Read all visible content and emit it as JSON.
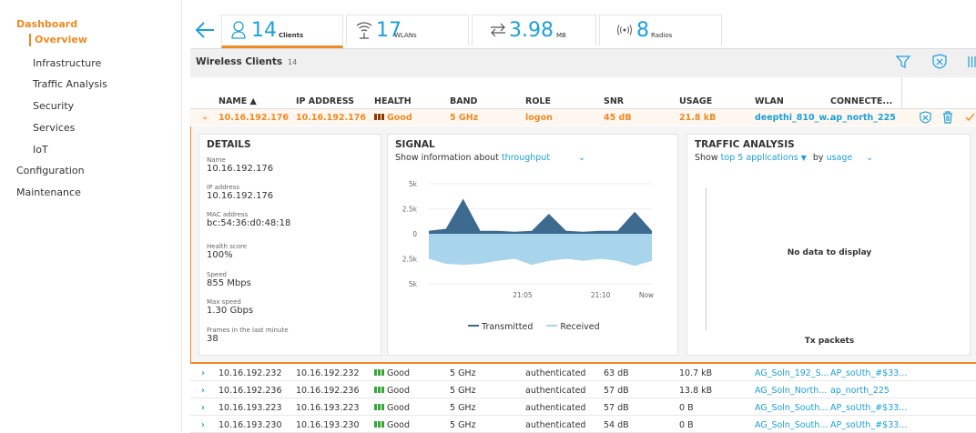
{
  "sidebar": {
    "dashboard": "Dashboard",
    "overview": "Overview",
    "sub_items": [
      "Infrastructure",
      "Traffic Analysis",
      "Security",
      "Services",
      "IoT"
    ],
    "configuration": "Configuration",
    "maintenance": "Maintenance"
  },
  "tabs": {
    "clients": {
      "num": "14",
      "label": "Clients"
    },
    "wlans": {
      "num": "17",
      "label": "WLANs"
    },
    "usage": {
      "num": "3.98",
      "label": "MB"
    },
    "radios": {
      "num": "8",
      "label": "Radios"
    }
  },
  "table": {
    "title": "Wireless Clients",
    "count": "14",
    "columns": [
      "NAME ▲",
      "IP ADDRESS",
      "HEALTH",
      "BAND",
      "ROLE",
      "SNR",
      "USAGE",
      "WLAN",
      "CONNECTE..."
    ],
    "selected": {
      "name": "10.16.192.176",
      "ip": "10.16.192.176",
      "health": "Good",
      "band": "5 GHz",
      "role": "logon",
      "snr": "45 dB",
      "usage": "21.8 kB",
      "wlan": "deepthi_810_w...",
      "connected": "ap_north_225"
    },
    "rows": [
      {
        "name": "10.16.192.232",
        "ip": "10.16.192.232",
        "health": "Good",
        "band": "5 GHz",
        "role": "authenticated",
        "snr": "63 dB",
        "usage": "10.7 kB",
        "wlan": "AG_Soln_192_S...",
        "connected": "AP_soUth_#$33..."
      },
      {
        "name": "10.16.192.236",
        "ip": "10.16.192.236",
        "health": "Good",
        "band": "5 GHz",
        "role": "authenticated",
        "snr": "57 dB",
        "usage": "13.8 kB",
        "wlan": "AG_Soln_North...",
        "connected": "ap_north_225"
      },
      {
        "name": "10.16.193.223",
        "ip": "10.16.193.223",
        "health": "Good",
        "band": "5 GHz",
        "role": "authenticated",
        "snr": "57 dB",
        "usage": "0 B",
        "wlan": "AG_Soln_South...",
        "connected": "AP_soUth_#$33..."
      },
      {
        "name": "10.16.193.230",
        "ip": "10.16.193.230",
        "health": "Good",
        "band": "5 GHz",
        "role": "authenticated",
        "snr": "54 dB",
        "usage": "0 B",
        "wlan": "AG_Soln_South...",
        "connected": "AP_soUth_#$33..."
      }
    ]
  },
  "details": {
    "title": "DETAILS",
    "fields": [
      {
        "label": "Name",
        "value": "10.16.192.176"
      },
      {
        "label": "IP address",
        "value": "10.16.192.176"
      },
      {
        "label": "MAC address",
        "value": "bc:54:36:d0:48:18"
      },
      {
        "label": "Health score",
        "value": "100%"
      },
      {
        "label": "Speed",
        "value": "855 Mbps"
      },
      {
        "label": "Max speed",
        "value": "1.30 Gbps"
      },
      {
        "label": "Frames in the last minute",
        "value": "38"
      }
    ]
  },
  "signal": {
    "title": "SIGNAL",
    "prefix": "Show information about",
    "selector": "throughput",
    "legend_tx": "Transmitted",
    "legend_rx": "Received",
    "tx_color": "#3d6a8f",
    "rx_color": "#a8d5ec"
  },
  "chart_data": {
    "type": "area",
    "yticks": [
      "5k",
      "2.5k",
      "0",
      "2.5k",
      "5k"
    ],
    "xticks": [
      "21:05",
      "21:10",
      "Now"
    ],
    "ylim": [
      -5000,
      5000
    ],
    "series": [
      {
        "name": "Transmitted",
        "values": [
          300,
          500,
          3500,
          300,
          300,
          200,
          300,
          2000,
          300,
          200,
          300,
          300,
          2200,
          300
        ]
      },
      {
        "name": "Received",
        "values": [
          -2500,
          -3000,
          -3100,
          -3000,
          -2700,
          -2500,
          -3100,
          -2700,
          -2500,
          -2700,
          -2500,
          -2700,
          -3200,
          -2700
        ]
      }
    ]
  },
  "traffic": {
    "title": "TRAFFIC ANALYSIS",
    "show": "Show",
    "selector": "top 5 applications",
    "by": "by",
    "by_selector": "usage",
    "empty": "No data to display",
    "xlabel": "Tx packets"
  }
}
